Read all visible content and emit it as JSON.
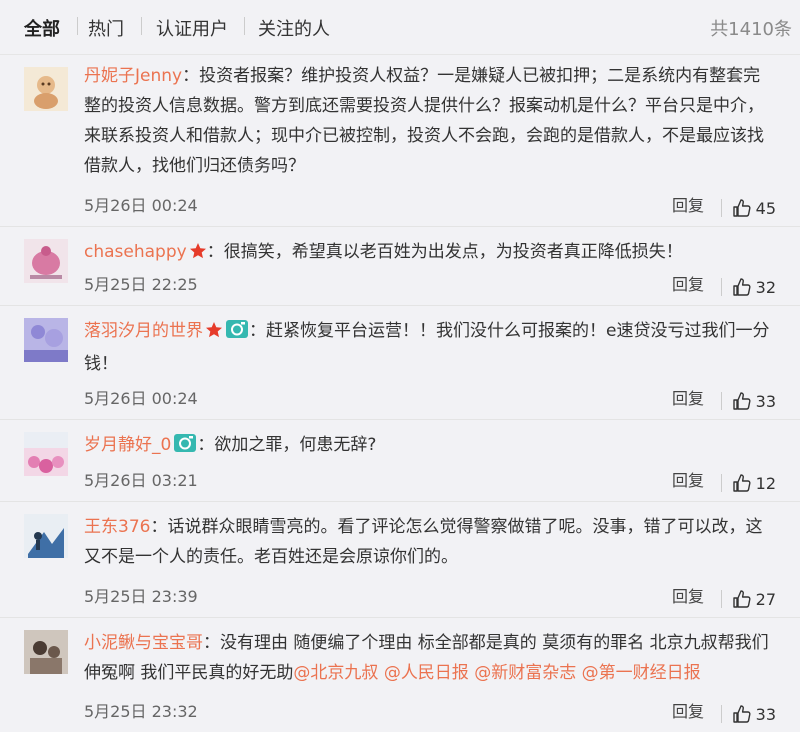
{
  "tabs": [
    "全部",
    "热门",
    "认证用户",
    "关注的人"
  ],
  "total": "共1410条",
  "reply_label": "回复",
  "comments": [
    {
      "user": "丹妮子Jenny",
      "text": "：投资者报案？维护投资人权益？一是嫌疑人已被扣押；二是系统内有整套完整的投资人信息数据。警方到底还需要投资人提供什么？报案动机是什么？平台只是中介，来联系投资人和借款人；现中介已被控制，投资人不会跑，会跑的是借款人，不是最应该找借款人，找他们归还债务吗？",
      "time": "5月26日 00:24",
      "likes": "45"
    },
    {
      "user": "chasehappy",
      "text": "：很搞笑，希望真以老百姓为出发点，为投资者真正降低损失！",
      "time": "5月25日 22:25",
      "likes": "32"
    },
    {
      "user": "落羽汐月的世界",
      "text": "：赶紧恢复平台运营！！我们没什么可报案的！e速贷没亏过我们一分钱！",
      "time": "5月26日 00:24",
      "likes": "33"
    },
    {
      "user": "岁月静好_0",
      "text": "：欲加之罪，何患无辞?",
      "time": "5月26日 03:21",
      "likes": "12"
    },
    {
      "user": "王东376",
      "text": "：话说群众眼睛雪亮的。看了评论怎么觉得警察做错了呢。没事，错了可以改，这又不是一个人的责任。老百姓还是会原谅你们的。",
      "time": "5月25日 23:39",
      "likes": "27"
    },
    {
      "user": "小泥鳅与宝宝哥",
      "text": "：没有理由 随便编了个理由 标全部都是真的 莫须有的罪名 北京九叔帮我们伸冤啊 我们平民真的好无助",
      "mentions": [
        "@北京九叔",
        "@人民日报",
        "@新财富杂志",
        "@第一财经日报"
      ],
      "time": "5月25日 23:32",
      "likes": "33"
    }
  ]
}
